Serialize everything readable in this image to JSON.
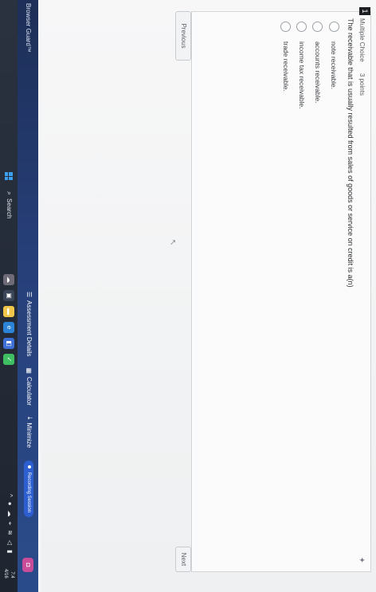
{
  "question": {
    "number": "1",
    "type": "Multiple Choice",
    "points": "3 points",
    "text": "The receivable that is usually resulted from sales of goods or service on credit is a(n)",
    "options": [
      "note receivable.",
      "accounts receivable.",
      "income tax receivable.",
      "trade receivable."
    ]
  },
  "nav": {
    "previous": "Previous",
    "next": "Next"
  },
  "guard_bar": {
    "title": "Browser Guard™",
    "tools": [
      {
        "icon": "list-icon",
        "label": "Assessment Details"
      },
      {
        "icon": "calculator-icon",
        "label": "Calculator"
      },
      {
        "icon": "minimize-icon",
        "label": "Minimize"
      }
    ],
    "more_icon": "⋮⋮",
    "recording": "Recording Session",
    "app_badge_icon": "shield-icon"
  },
  "taskbar": {
    "search_label": "Search",
    "tray_caret": "^",
    "clock_time": "7:4",
    "clock_date": "4/16"
  },
  "colors": {
    "guard_bar": "#27407a",
    "recording_badge": "#2e5fd1",
    "app_badge": "#c84c98"
  }
}
